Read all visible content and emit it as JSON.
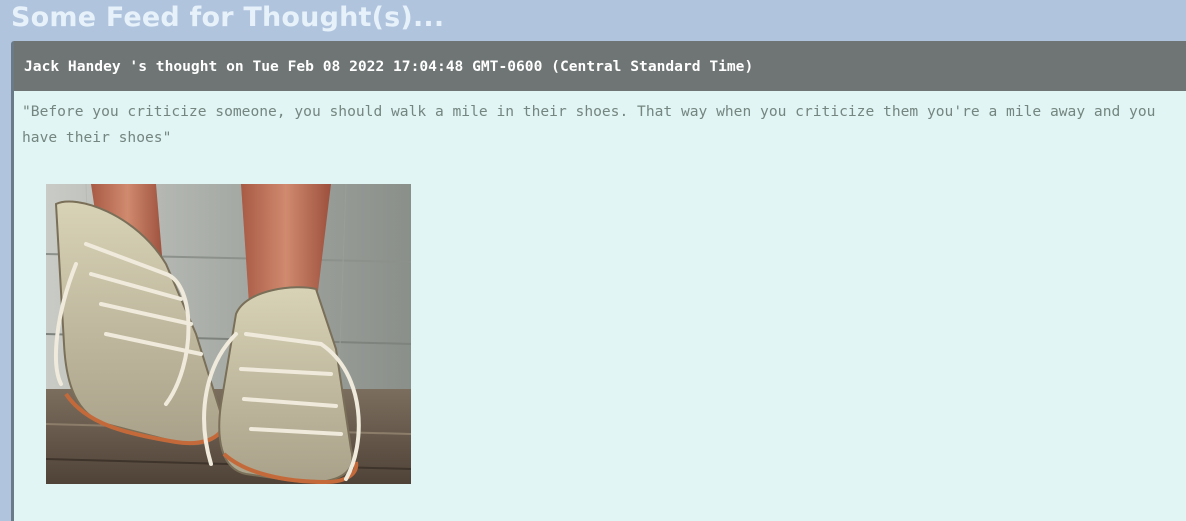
{
  "page": {
    "title": "Some Feed for Thought(s)..."
  },
  "thought": {
    "header": "Jack Handey 's thought on Tue Feb 08 2022 17:04:48 GMT-0600 (Central Standard Time)",
    "quote": "\"Before you criticize someone, you should walk a mile in their shoes. That way when you criticize them you're a mile away and you have their shoes\"",
    "image": {
      "subject": "worn-out canvas sneakers photo",
      "alt": ""
    }
  },
  "colors": {
    "page_background": "#b0c4de",
    "title_text": "#e6f1fa",
    "card_background": "#e0f5f4",
    "header_background": "#6e7574",
    "header_text": "#ffffff",
    "quote_text": "#75857f"
  }
}
